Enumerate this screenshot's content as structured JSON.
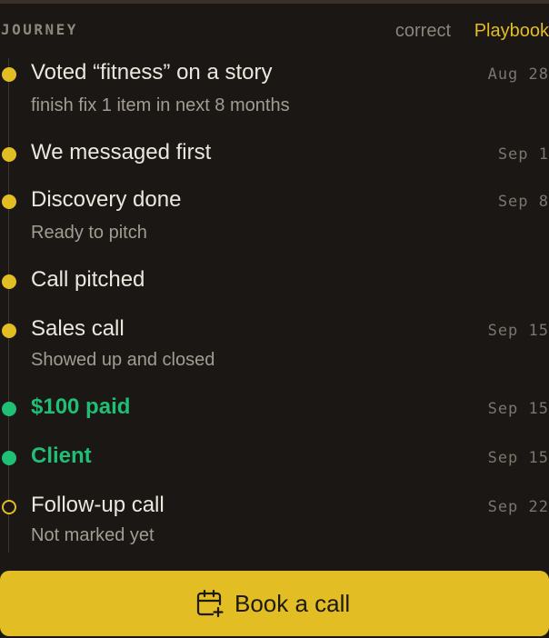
{
  "header": {
    "title": "JOURNEY",
    "correct_label": "correct",
    "playbook_label": "Playbook"
  },
  "events": [
    {
      "title": "Voted “fitness” on a story",
      "subtitle": "finish fix 1 item in next 8 months",
      "date": "Aug 28",
      "status": "done"
    },
    {
      "title": "We messaged first",
      "subtitle": "",
      "date": "Sep 1",
      "status": "done"
    },
    {
      "title": "Discovery done",
      "subtitle": "Ready to pitch",
      "date": "Sep 8",
      "status": "done"
    },
    {
      "title": "Call pitched",
      "subtitle": "",
      "date": "",
      "status": "done"
    },
    {
      "title": "Sales call",
      "subtitle": "Showed up and closed",
      "date": "Sep 15",
      "status": "done"
    },
    {
      "title": "$100 paid",
      "subtitle": "",
      "date": "Sep 15",
      "status": "success"
    },
    {
      "title": "Client",
      "subtitle": "",
      "date": "Sep 15",
      "status": "success"
    },
    {
      "title": "Follow-up call",
      "subtitle": "Not marked yet",
      "date": "Sep 22",
      "status": "pending"
    }
  ],
  "cta": {
    "label": "Book a call",
    "icon": "calendar-plus-icon"
  },
  "colors": {
    "background": "#1a1714",
    "accent": "#e2bd23",
    "success": "#1fbf76",
    "muted": "#7b766d"
  }
}
